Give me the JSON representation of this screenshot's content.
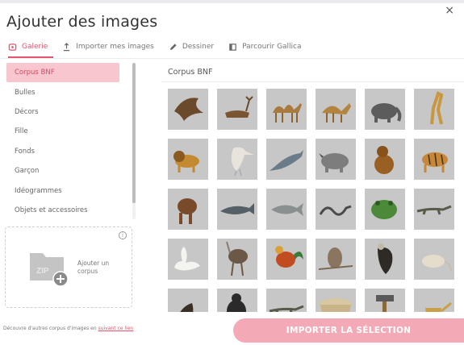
{
  "dialog": {
    "title": "Ajouter des images",
    "close_label": "×"
  },
  "tabs": [
    {
      "label": "Galerie",
      "icon": "gallery-icon",
      "active": true
    },
    {
      "label": "Importer mes images",
      "icon": "upload-icon",
      "active": false
    },
    {
      "label": "Dessiner",
      "icon": "pencil-icon",
      "active": false
    },
    {
      "label": "Parcourir Gallica",
      "icon": "book-icon",
      "active": false
    }
  ],
  "sidebar": {
    "items": [
      {
        "label": "Corpus BNF",
        "active": true
      },
      {
        "label": "Bulles"
      },
      {
        "label": "Décors"
      },
      {
        "label": "Fille"
      },
      {
        "label": "Fonds"
      },
      {
        "label": "Garçon"
      },
      {
        "label": "Idéogrammes"
      },
      {
        "label": "Objets et accessoires"
      }
    ]
  },
  "upload": {
    "label": "Ajouter un corpus",
    "info": "i",
    "icon": "add-folder-icon"
  },
  "bottom_note": {
    "text": "Découvre d'autres corpus d'images en ",
    "link": "suivant ce lien"
  },
  "main": {
    "title": "Corpus BNF"
  },
  "gallery": [
    {
      "animal": "eagle"
    },
    {
      "animal": "deer"
    },
    {
      "animal": "camel"
    },
    {
      "animal": "dromedary"
    },
    {
      "animal": "elephant"
    },
    {
      "animal": "giraffe"
    },
    {
      "animal": "lion"
    },
    {
      "animal": "pelican"
    },
    {
      "animal": "swordfish"
    },
    {
      "animal": "rhinoceros"
    },
    {
      "animal": "monkey"
    },
    {
      "animal": "tiger"
    },
    {
      "animal": "calf"
    },
    {
      "animal": "whale"
    },
    {
      "animal": "fish"
    },
    {
      "animal": "snake"
    },
    {
      "animal": "frog"
    },
    {
      "animal": "lizard"
    },
    {
      "animal": "swan"
    },
    {
      "animal": "ostrich"
    },
    {
      "animal": "rooster"
    },
    {
      "animal": "owl"
    },
    {
      "animal": "vulture"
    },
    {
      "animal": "rat"
    },
    {
      "animal": "hawk"
    },
    {
      "animal": "gorilla"
    },
    {
      "animal": "lizard"
    },
    {
      "animal": "basket"
    },
    {
      "animal": "hammer"
    },
    {
      "animal": "watering-can"
    }
  ],
  "import_button": {
    "label": "IMPORTER LA SÉLECTION"
  },
  "colors": {
    "accent": "#e0566f",
    "active_bg": "#f7c6cf",
    "button_bg": "#f4a9b7",
    "tile_bg": "#c7c7c7"
  }
}
